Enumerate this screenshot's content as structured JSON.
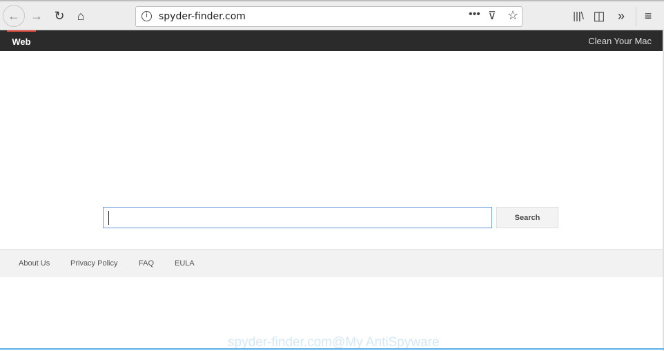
{
  "browser": {
    "url": "spyder-finder.com"
  },
  "nav": {
    "web": "Web",
    "clean": "Clean Your Mac",
    "accent": "#e04a3f"
  },
  "search": {
    "value": "",
    "button": "Search"
  },
  "footer": {
    "links": [
      "About Us",
      "Privacy Policy",
      "FAQ",
      "EULA"
    ]
  },
  "watermark": "spyder-finder.com@My AntiSpyware"
}
